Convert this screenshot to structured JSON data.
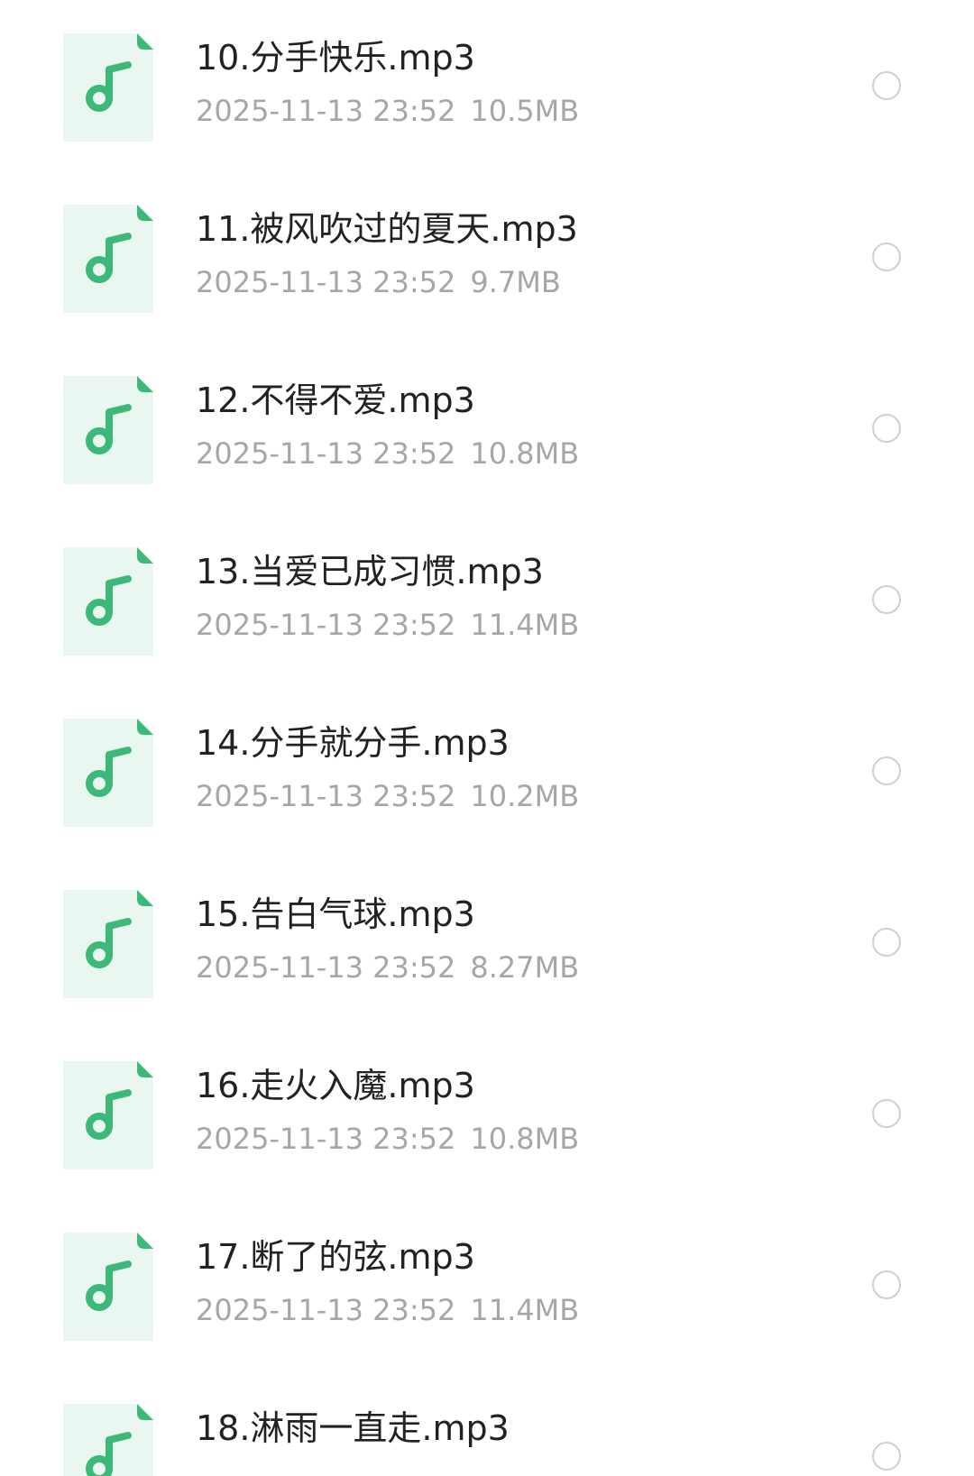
{
  "files": [
    {
      "name": "10.分手快乐.mp3",
      "datetime": "2025-11-13 23:52",
      "size": "10.5MB"
    },
    {
      "name": "11.被风吹过的夏天.mp3",
      "datetime": "2025-11-13 23:52",
      "size": "9.7MB"
    },
    {
      "name": "12.不得不爱.mp3",
      "datetime": "2025-11-13 23:52",
      "size": "10.8MB"
    },
    {
      "name": "13.当爱已成习惯.mp3",
      "datetime": "2025-11-13 23:52",
      "size": "11.4MB"
    },
    {
      "name": "14.分手就分手.mp3",
      "datetime": "2025-11-13 23:52",
      "size": "10.2MB"
    },
    {
      "name": "15.告白气球.mp3",
      "datetime": "2025-11-13 23:52",
      "size": "8.27MB"
    },
    {
      "name": "16.走火入魔.mp3",
      "datetime": "2025-11-13 23:52",
      "size": "10.8MB"
    },
    {
      "name": "17.断了的弦.mp3",
      "datetime": "2025-11-13 23:52",
      "size": "11.4MB"
    },
    {
      "name": "18.淋雨一直走.mp3"
    }
  ],
  "icon": {
    "name": "music-file-icon",
    "note_color": "#3cb878",
    "background_color": "#eaf7f0"
  },
  "colors": {
    "title_text": "#222222",
    "meta_text": "#a6a6a6",
    "radio_border": "#cfcfcf"
  }
}
